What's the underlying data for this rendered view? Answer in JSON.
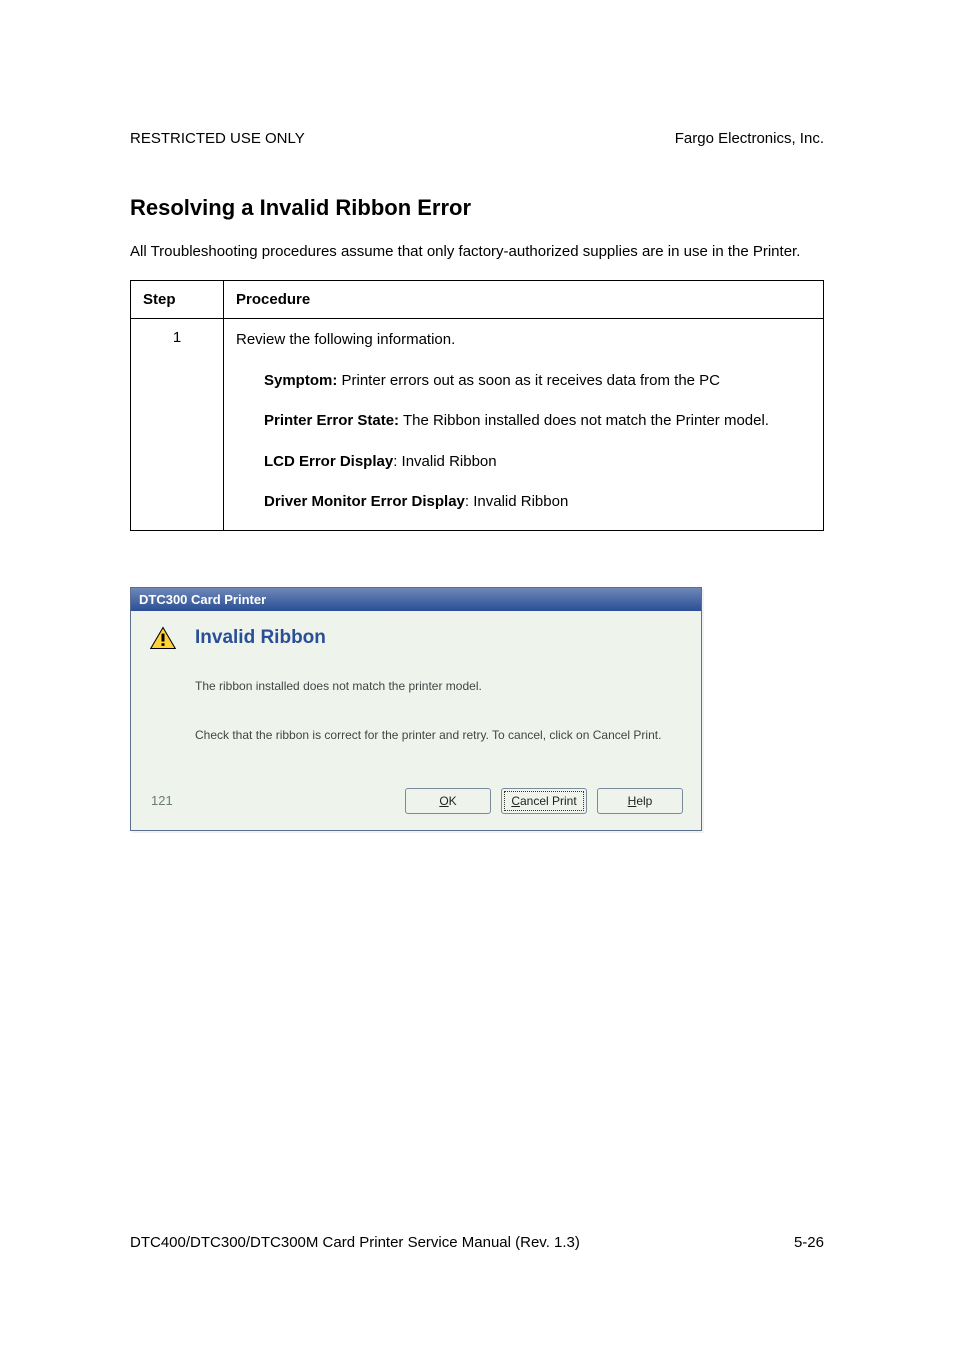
{
  "header": {
    "left": "RESTRICTED USE ONLY",
    "right": "Fargo Electronics, Inc."
  },
  "section": {
    "title": "Resolving a Invalid Ribbon Error",
    "intro": "All Troubleshooting procedures assume that only factory-authorized supplies are in use in the Printer."
  },
  "table": {
    "headers": {
      "step": "Step",
      "procedure": "Procedure"
    },
    "row": {
      "step": "1",
      "line1": "Review the following information.",
      "symptom_label": "Symptom:",
      "symptom_text": " Printer errors out as soon as it receives data from the PC",
      "state_label": "Printer Error State:",
      "state_text": " The Ribbon installed does not match the Printer model.",
      "lcd_label": "LCD Error Display",
      "lcd_text": ": Invalid Ribbon",
      "driver_label": "Driver Monitor Error Display",
      "driver_text": ": Invalid Ribbon"
    }
  },
  "dialog": {
    "title": "DTC300 Card Printer",
    "heading": "Invalid Ribbon",
    "msg1": "The ribbon installed does not match the printer model.",
    "msg2": "Check that the ribbon is correct for the printer and retry. To cancel, click on Cancel Print.",
    "code": "121",
    "buttons": {
      "ok_mn": "O",
      "ok_rest": "K",
      "cancel_mn": "C",
      "cancel_rest": "ancel Print",
      "help_mn": "H",
      "help_rest": "elp"
    }
  },
  "footer": {
    "left": "DTC400/DTC300/DTC300M Card Printer Service Manual (Rev. 1.3)",
    "right": "5-26"
  }
}
